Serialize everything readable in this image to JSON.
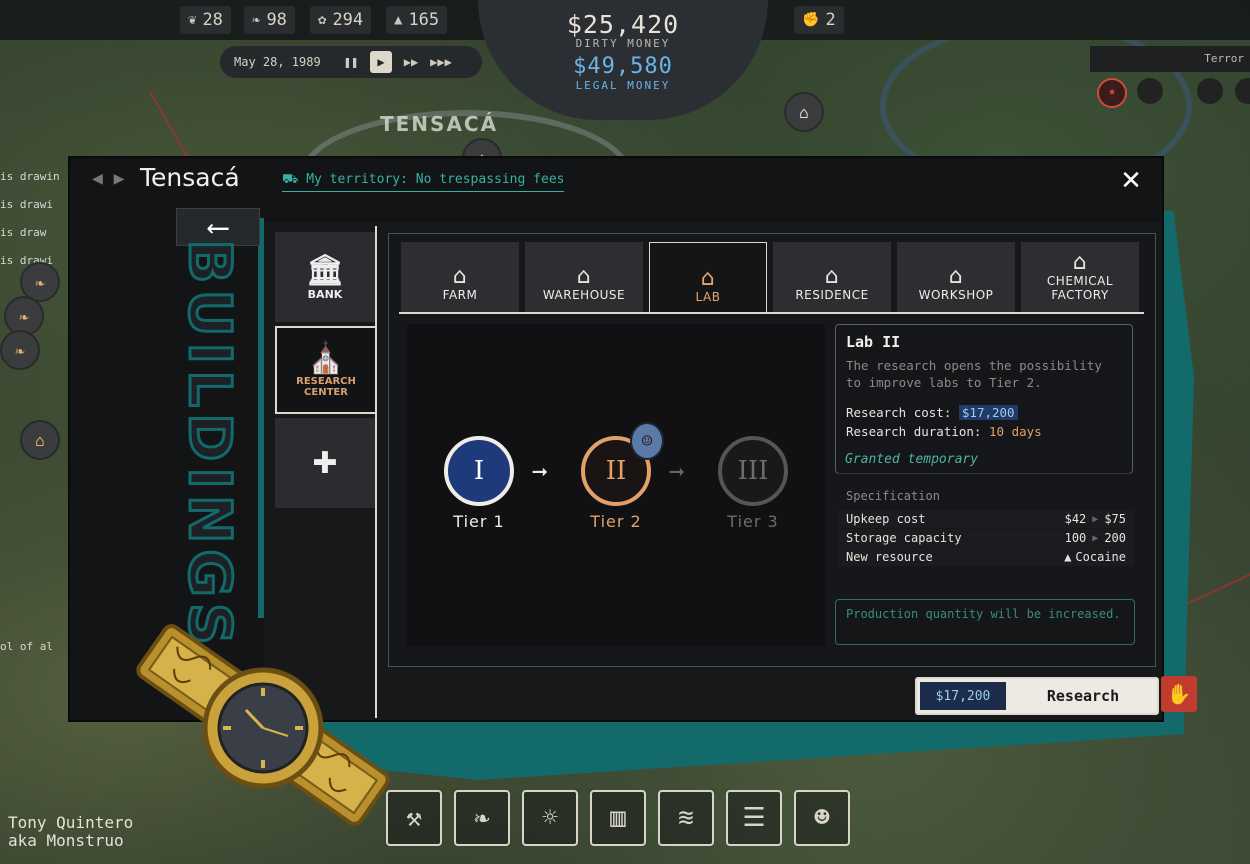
{
  "resources": [
    {
      "icon": "plant-icon",
      "glyph": "❦",
      "value": "28"
    },
    {
      "icon": "leaf-icon",
      "glyph": "❧",
      "value": "98"
    },
    {
      "icon": "herb-icon",
      "glyph": "✿",
      "value": "294"
    },
    {
      "icon": "powder-icon",
      "glyph": "▲",
      "value": "165"
    }
  ],
  "workers": {
    "value": "2"
  },
  "money": {
    "dirty_value": "$25,420",
    "dirty_label": "DIRTY MONEY",
    "legal_value": "$49,580",
    "legal_label": "LEGAL MONEY"
  },
  "time": {
    "date": "May 28, 1989"
  },
  "map": {
    "town_label": "TENSACÁ",
    "side_text": [
      "is drawin",
      "is drawi",
      "is draw",
      "is drawi"
    ],
    "side_text2": "ol of al",
    "terror_label": "Terror"
  },
  "window": {
    "town_name": "Tensacá",
    "territory_text": "My territory: No trespassing fees",
    "section_title": "BUILDINGS"
  },
  "sidenav": [
    {
      "label": "BANK",
      "glyph": "🏛"
    },
    {
      "label": "RESEARCH CENTER",
      "glyph": "⛪"
    }
  ],
  "tabs": [
    {
      "label": "FARM",
      "glyph": "⌂"
    },
    {
      "label": "WAREHOUSE",
      "glyph": "⌂"
    },
    {
      "label": "LAB",
      "glyph": "⌂"
    },
    {
      "label": "RESIDENCE",
      "glyph": "⌂"
    },
    {
      "label": "WORKSHOP",
      "glyph": "⌂"
    },
    {
      "label": "CHEMICAL FACTORY",
      "glyph": "⌂"
    }
  ],
  "tiers": [
    {
      "numeral": "I",
      "label": "Tier 1"
    },
    {
      "numeral": "II",
      "label": "Tier 2"
    },
    {
      "numeral": "III",
      "label": "Tier 3"
    }
  ],
  "info": {
    "title": "Lab II",
    "description": "The research opens the possibility to improve labs to Tier 2.",
    "cost_label": "Research cost:",
    "cost_value": "$17,200",
    "duration_label": "Research duration:",
    "duration_value": "10 days",
    "granted": "Granted temporary"
  },
  "spec": {
    "title": "Specification",
    "rows": [
      {
        "key": "Upkeep cost",
        "from": "$42",
        "to": "$75"
      },
      {
        "key": "Storage capacity",
        "from": "100",
        "to": "200"
      },
      {
        "key": "New resource",
        "value": "Cocaine"
      }
    ]
  },
  "note": "Production quantity will be increased.",
  "action": {
    "price": "$17,200",
    "label": "Research"
  },
  "bottom_buttons": [
    {
      "icon": "hammer-icon",
      "glyph": "⚒"
    },
    {
      "icon": "leaf-icon",
      "glyph": "❧"
    },
    {
      "icon": "lightbulb-icon",
      "glyph": "☼"
    },
    {
      "icon": "chart-icon",
      "glyph": "▥"
    },
    {
      "icon": "layers-icon",
      "glyph": "≋"
    },
    {
      "icon": "clipboard-icon",
      "glyph": "☰"
    },
    {
      "icon": "people-icon",
      "glyph": "☻"
    }
  ],
  "character": {
    "name": "Tony Quintero",
    "alias": "aka Monstruo"
  },
  "colors": {
    "accent_teal": "#136a6a",
    "lab_orange": "#e2a06a",
    "legal_blue": "#6ab4e8",
    "tier1_blue": "#1e3a7a"
  }
}
